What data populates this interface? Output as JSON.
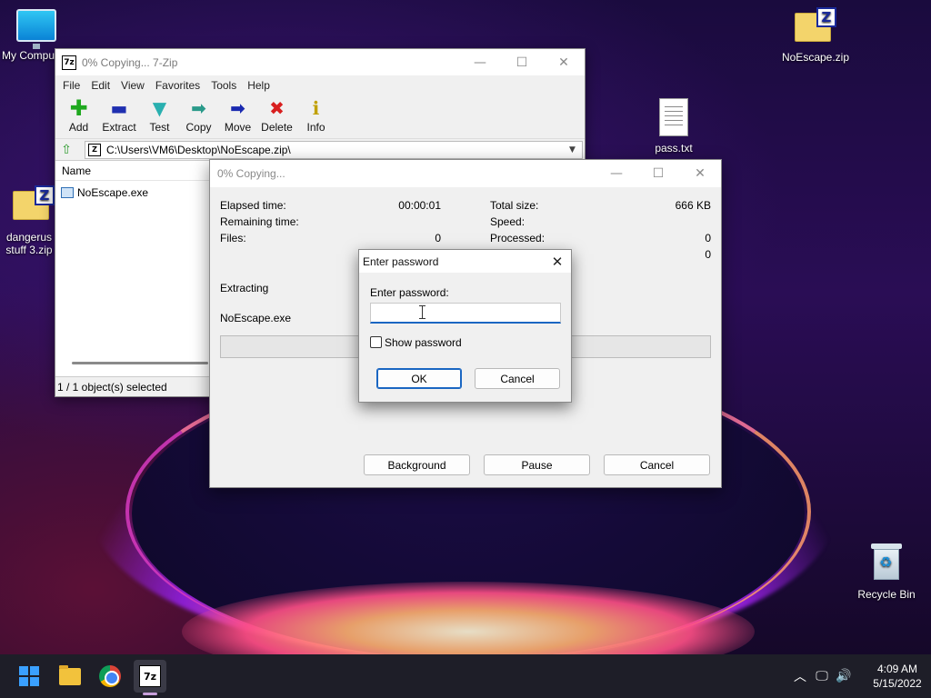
{
  "desktop": {
    "icons": [
      {
        "label": "My Compu",
        "icon": "monitor-icon"
      },
      {
        "label": "dangerus stuff 3.zip",
        "icon": "zip-folder-icon"
      },
      {
        "label": "NoEscape.zip",
        "icon": "zip-folder-icon"
      },
      {
        "label": "pass.txt",
        "icon": "text-file-icon"
      },
      {
        "label": "Recycle Bin",
        "icon": "recycle-bin-icon"
      }
    ]
  },
  "main_window": {
    "app_icon_text": "7z",
    "title": "0% Copying... 7-Zip",
    "menu": [
      "File",
      "Edit",
      "View",
      "Favorites",
      "Tools",
      "Help"
    ],
    "toolbar": [
      {
        "label": "Add",
        "icon": "plus-icon",
        "color": "#1fa81f"
      },
      {
        "label": "Extract",
        "icon": "minus-icon",
        "color": "#1f2fb0"
      },
      {
        "label": "Test",
        "icon": "check-icon",
        "color": "#2ab0b0"
      },
      {
        "label": "Copy",
        "icon": "arrow-right-icon",
        "color": "#2a9a8a"
      },
      {
        "label": "Move",
        "icon": "arrow-right-icon",
        "color": "#1a2ab0"
      },
      {
        "label": "Delete",
        "icon": "x-icon",
        "color": "#d81f1f"
      },
      {
        "label": "Info",
        "icon": "info-icon",
        "color": "#c0a000"
      }
    ],
    "address": "C:\\Users\\VM6\\Desktop\\NoEscape.zip\\",
    "column_header": "Name",
    "files": [
      "NoEscape.exe"
    ],
    "status": "1 / 1 object(s) selected"
  },
  "progress_window": {
    "title": "0% Copying...",
    "left_stats": [
      {
        "label": "Elapsed time:",
        "value": "00:00:01"
      },
      {
        "label": "Remaining time:",
        "value": ""
      },
      {
        "label": "Files:",
        "value": "0"
      }
    ],
    "right_stats": [
      {
        "label": "Total size:",
        "value": "666 KB"
      },
      {
        "label": "Speed:",
        "value": ""
      },
      {
        "label": "Processed:",
        "value": "0"
      },
      {
        "label": "",
        "value": "0"
      }
    ],
    "operation": "Extracting",
    "current_file": "NoEscape.exe",
    "progress": 0,
    "buttons": {
      "background": "Background",
      "pause": "Pause",
      "cancel": "Cancel"
    }
  },
  "password_dialog": {
    "title": "Enter password",
    "label": "Enter password:",
    "value": "",
    "show_password_label": "Show password",
    "show_password_checked": false,
    "ok": "OK",
    "cancel": "Cancel"
  },
  "taskbar": {
    "apps": [
      "start-icon",
      "file-explorer-icon",
      "chrome-icon",
      "7zip-icon"
    ],
    "zip_icon_text": "7z",
    "time": "4:09 AM",
    "date": "5/15/2022"
  }
}
